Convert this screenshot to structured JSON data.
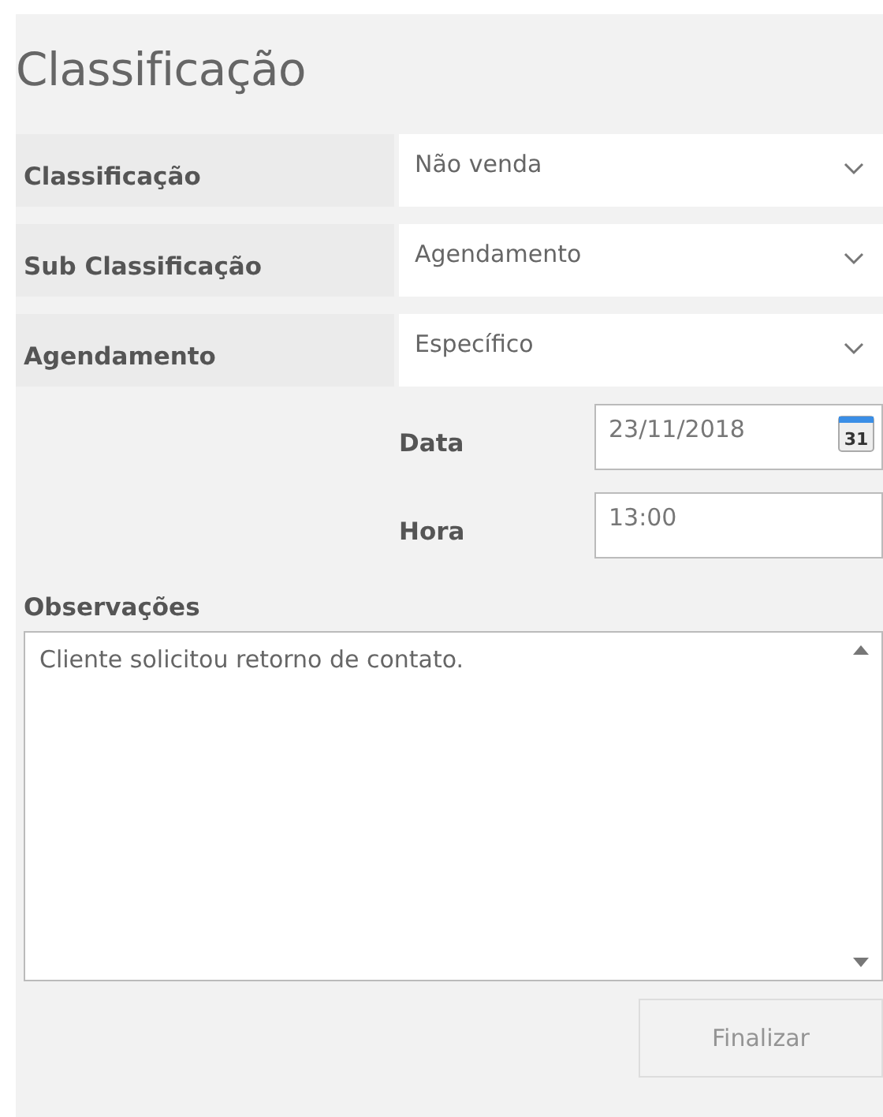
{
  "title": "Classificação",
  "selects": [
    {
      "label": "Classificação",
      "value": "Não venda"
    },
    {
      "label": "Sub Classificação",
      "value": "Agendamento"
    },
    {
      "label": "Agendamento",
      "value": "Específico"
    }
  ],
  "schedule": [
    {
      "kind": "date",
      "label": "Data",
      "value": "23/11/2018",
      "calendar_day": "31"
    },
    {
      "kind": "time",
      "label": "Hora",
      "value": "13:00"
    }
  ],
  "notes": {
    "label": "Observações",
    "value": "Cliente solicitou retorno de contato."
  },
  "finish_button": {
    "label": "Finalizar",
    "disabled": true
  }
}
